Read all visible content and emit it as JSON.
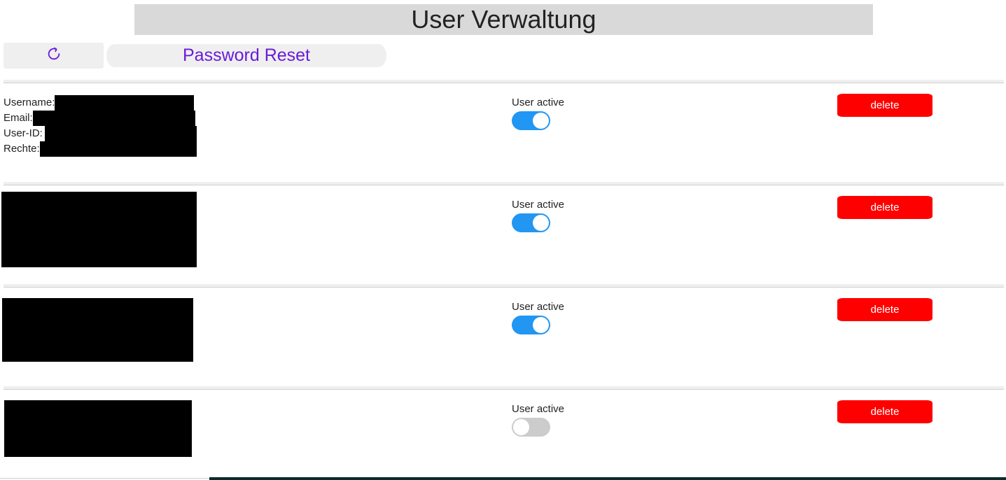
{
  "header": {
    "title": "User Verwaltung"
  },
  "toolbar": {
    "refresh_icon": "refresh-icon",
    "password_reset_label": "Password Reset"
  },
  "colors": {
    "accent": "#6a1bd9",
    "toggle_on": "#2196f3",
    "toggle_off": "#cccccc",
    "delete": "#ff0000"
  },
  "users": [
    {
      "labels": {
        "username": "Username:",
        "email": "Email:",
        "user_id": "User-ID:",
        "rechte": "Rechte:"
      },
      "active_label": "User active",
      "active": true,
      "delete_label": "delete"
    },
    {
      "active_label": "User active",
      "active": true,
      "delete_label": "delete"
    },
    {
      "active_label": "User active",
      "active": true,
      "delete_label": "delete"
    },
    {
      "active_label": "User active",
      "active": false,
      "delete_label": "delete"
    }
  ]
}
